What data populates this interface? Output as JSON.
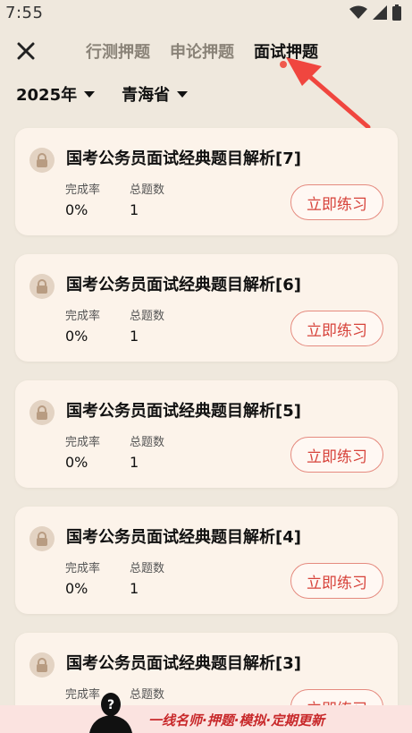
{
  "status": {
    "time": "7:55"
  },
  "tabs": [
    "行测押题",
    "申论押题",
    "面试押题"
  ],
  "active_tab": 2,
  "filters": {
    "year": "2025年",
    "region": "青海省"
  },
  "labels": {
    "rate": "完成率",
    "total": "总题数",
    "practice": "立即练习"
  },
  "cards": [
    {
      "title": "国考公务员面试经典题目解析[7]",
      "rate": "0%",
      "total": "1"
    },
    {
      "title": "国考公务员面试经典题目解析[6]",
      "rate": "0%",
      "total": "1"
    },
    {
      "title": "国考公务员面试经典题目解析[5]",
      "rate": "0%",
      "total": "1"
    },
    {
      "title": "国考公务员面试经典题目解析[4]",
      "rate": "0%",
      "total": "1"
    },
    {
      "title": "国考公务员面试经典题目解析[3]",
      "rate": "",
      "total": ""
    }
  ],
  "banner": {
    "text": "一线名师·押题·模拟·定期更新"
  },
  "colors": {
    "accent": "#d7433b",
    "card_bg": "#fcf3ea",
    "page_bg": "#efe8dd"
  }
}
